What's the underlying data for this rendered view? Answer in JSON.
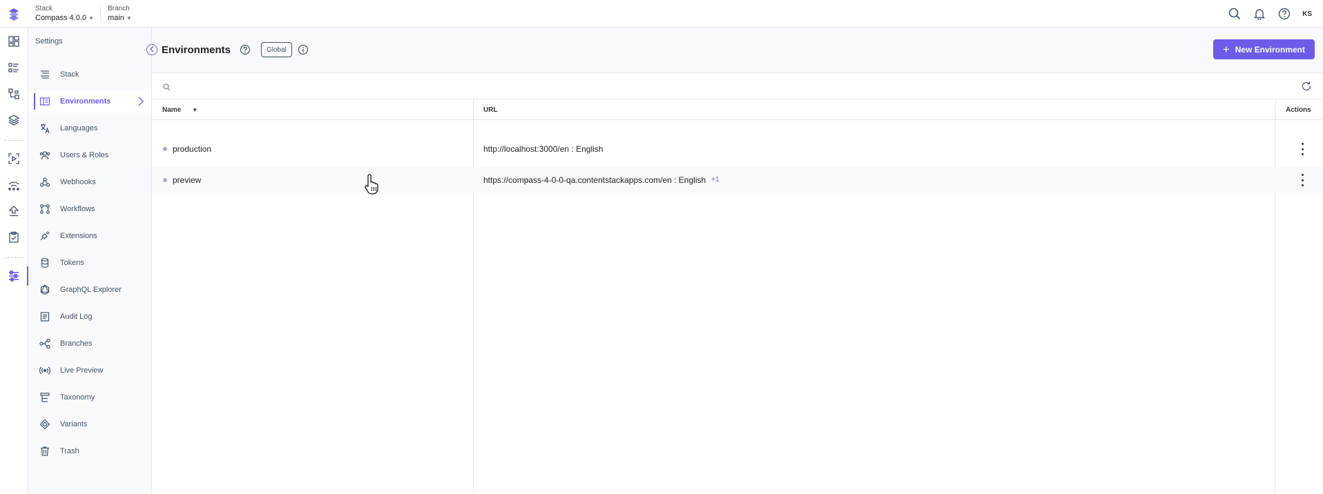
{
  "topbar": {
    "stack": {
      "label": "Stack",
      "value": "Compass 4.0.0"
    },
    "branch": {
      "label": "Branch",
      "value": "main"
    },
    "avatar_initials": "KS",
    "icons": [
      "search-icon",
      "bell-icon",
      "help-icon"
    ]
  },
  "rail": {
    "items": [
      "dashboard-icon",
      "entries-icon",
      "content-models-icon",
      "assets-icon",
      "releases-icon",
      "publish-queue-icon",
      "deploy-icon",
      "tasks-icon",
      "settings-icon"
    ]
  },
  "sidebar": {
    "title": "Settings",
    "items": [
      {
        "label": "Stack",
        "icon": "stack-icon"
      },
      {
        "label": "Environments",
        "icon": "environments-icon",
        "active": true
      },
      {
        "label": "Languages",
        "icon": "languages-icon"
      },
      {
        "label": "Users & Roles",
        "icon": "users-icon"
      },
      {
        "label": "Webhooks",
        "icon": "webhooks-icon"
      },
      {
        "label": "Workflows",
        "icon": "workflows-icon"
      },
      {
        "label": "Extensions",
        "icon": "extensions-icon"
      },
      {
        "label": "Tokens",
        "icon": "tokens-icon"
      },
      {
        "label": "GraphQL Explorer",
        "icon": "graphql-icon"
      },
      {
        "label": "Audit Log",
        "icon": "audit-log-icon"
      },
      {
        "label": "Branches",
        "icon": "branches-icon"
      },
      {
        "label": "Live Preview",
        "icon": "live-preview-icon"
      },
      {
        "label": "Taxonomy",
        "icon": "taxonomy-icon"
      },
      {
        "label": "Variants",
        "icon": "variants-icon"
      },
      {
        "label": "Trash",
        "icon": "trash-icon"
      }
    ]
  },
  "main": {
    "title": "Environments",
    "badge": "Global",
    "new_button_label": "New Environment",
    "search_placeholder": "",
    "columns": {
      "name": "Name",
      "url": "URL",
      "actions": "Actions"
    },
    "rows": [
      {
        "name": "production",
        "url": "http://localhost:3000/en : English",
        "extra": ""
      },
      {
        "name": "preview",
        "url": "https://compass-4-0-0-qa.contentstackapps.com/en : English",
        "extra": "+1"
      }
    ]
  },
  "colors": {
    "accent": "#6c5ce7",
    "sidebar_bg": "#f7f9fc",
    "border": "#e3e5ea",
    "muted_text": "#475161"
  }
}
